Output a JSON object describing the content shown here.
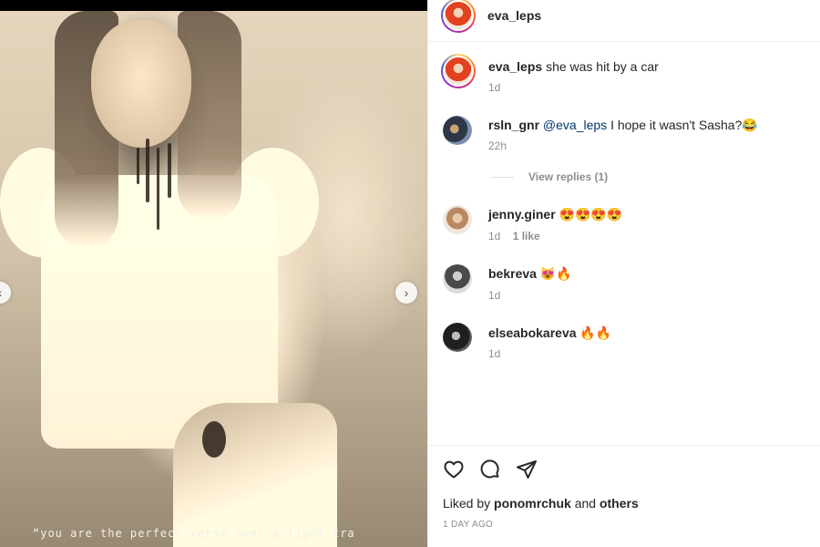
{
  "post": {
    "author": "eva_leps",
    "image_caption_overlay": "“you are the perfect verse over a tight tra",
    "caption": {
      "user": "eva_leps",
      "text": "she was hit by a car",
      "time": "1d"
    }
  },
  "comments": [
    {
      "user": "rsln_gnr",
      "mention": "@eva_leps",
      "text": "I hope it wasn't Sasha?😂",
      "time": "22h",
      "likes": "",
      "view_replies": "View replies (1)"
    },
    {
      "user": "jenny.giner",
      "mention": "",
      "text": "😍😍😍😍",
      "time": "1d",
      "likes": "1 like"
    },
    {
      "user": "bekreva",
      "mention": "",
      "text": "😻🔥",
      "time": "1d",
      "likes": ""
    },
    {
      "user": "elseabokareva",
      "mention": "",
      "text": "🔥🔥",
      "time": "1d",
      "likes": ""
    }
  ],
  "footer": {
    "liked_prefix": "Liked by",
    "liked_user": "ponomrchuk",
    "liked_and": "and",
    "liked_others": "others",
    "post_date": "1 DAY AGO"
  },
  "icons": {
    "like": "heart-icon",
    "comment": "comment-icon",
    "share": "paper-plane-icon",
    "prev": "chevron-left-icon",
    "next": "chevron-right-icon"
  }
}
